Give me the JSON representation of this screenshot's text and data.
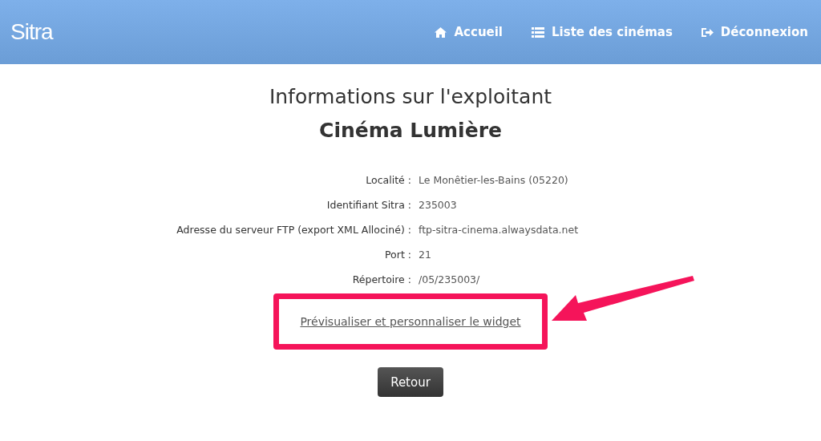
{
  "navbar": {
    "logo": "Sitra",
    "links": [
      {
        "kind": "home",
        "label": "Accueil"
      },
      {
        "kind": "list",
        "label": "Liste des cinémas"
      },
      {
        "kind": "logout",
        "label": "Déconnexion"
      }
    ]
  },
  "heading": {
    "title": "Informations sur l'exploitant",
    "subtitle": "Cinéma Lumière"
  },
  "details": [
    {
      "label": "Localité :",
      "value": "Le Monêtier-les-Bains (05220)"
    },
    {
      "label": "Identifiant Sitra :",
      "value": "235003"
    },
    {
      "label": "Adresse du serveur FTP (export XML Allociné) :",
      "value": "ftp-sitra-cinema.alwaysdata.net"
    },
    {
      "label": "Port :",
      "value": "21"
    },
    {
      "label": "Répertoire :",
      "value": "/05/235003/"
    }
  ],
  "widget_link": {
    "label": "Prévisualiser et personnaliser le widget",
    "highlighted": true
  },
  "back_button": "Retour"
}
